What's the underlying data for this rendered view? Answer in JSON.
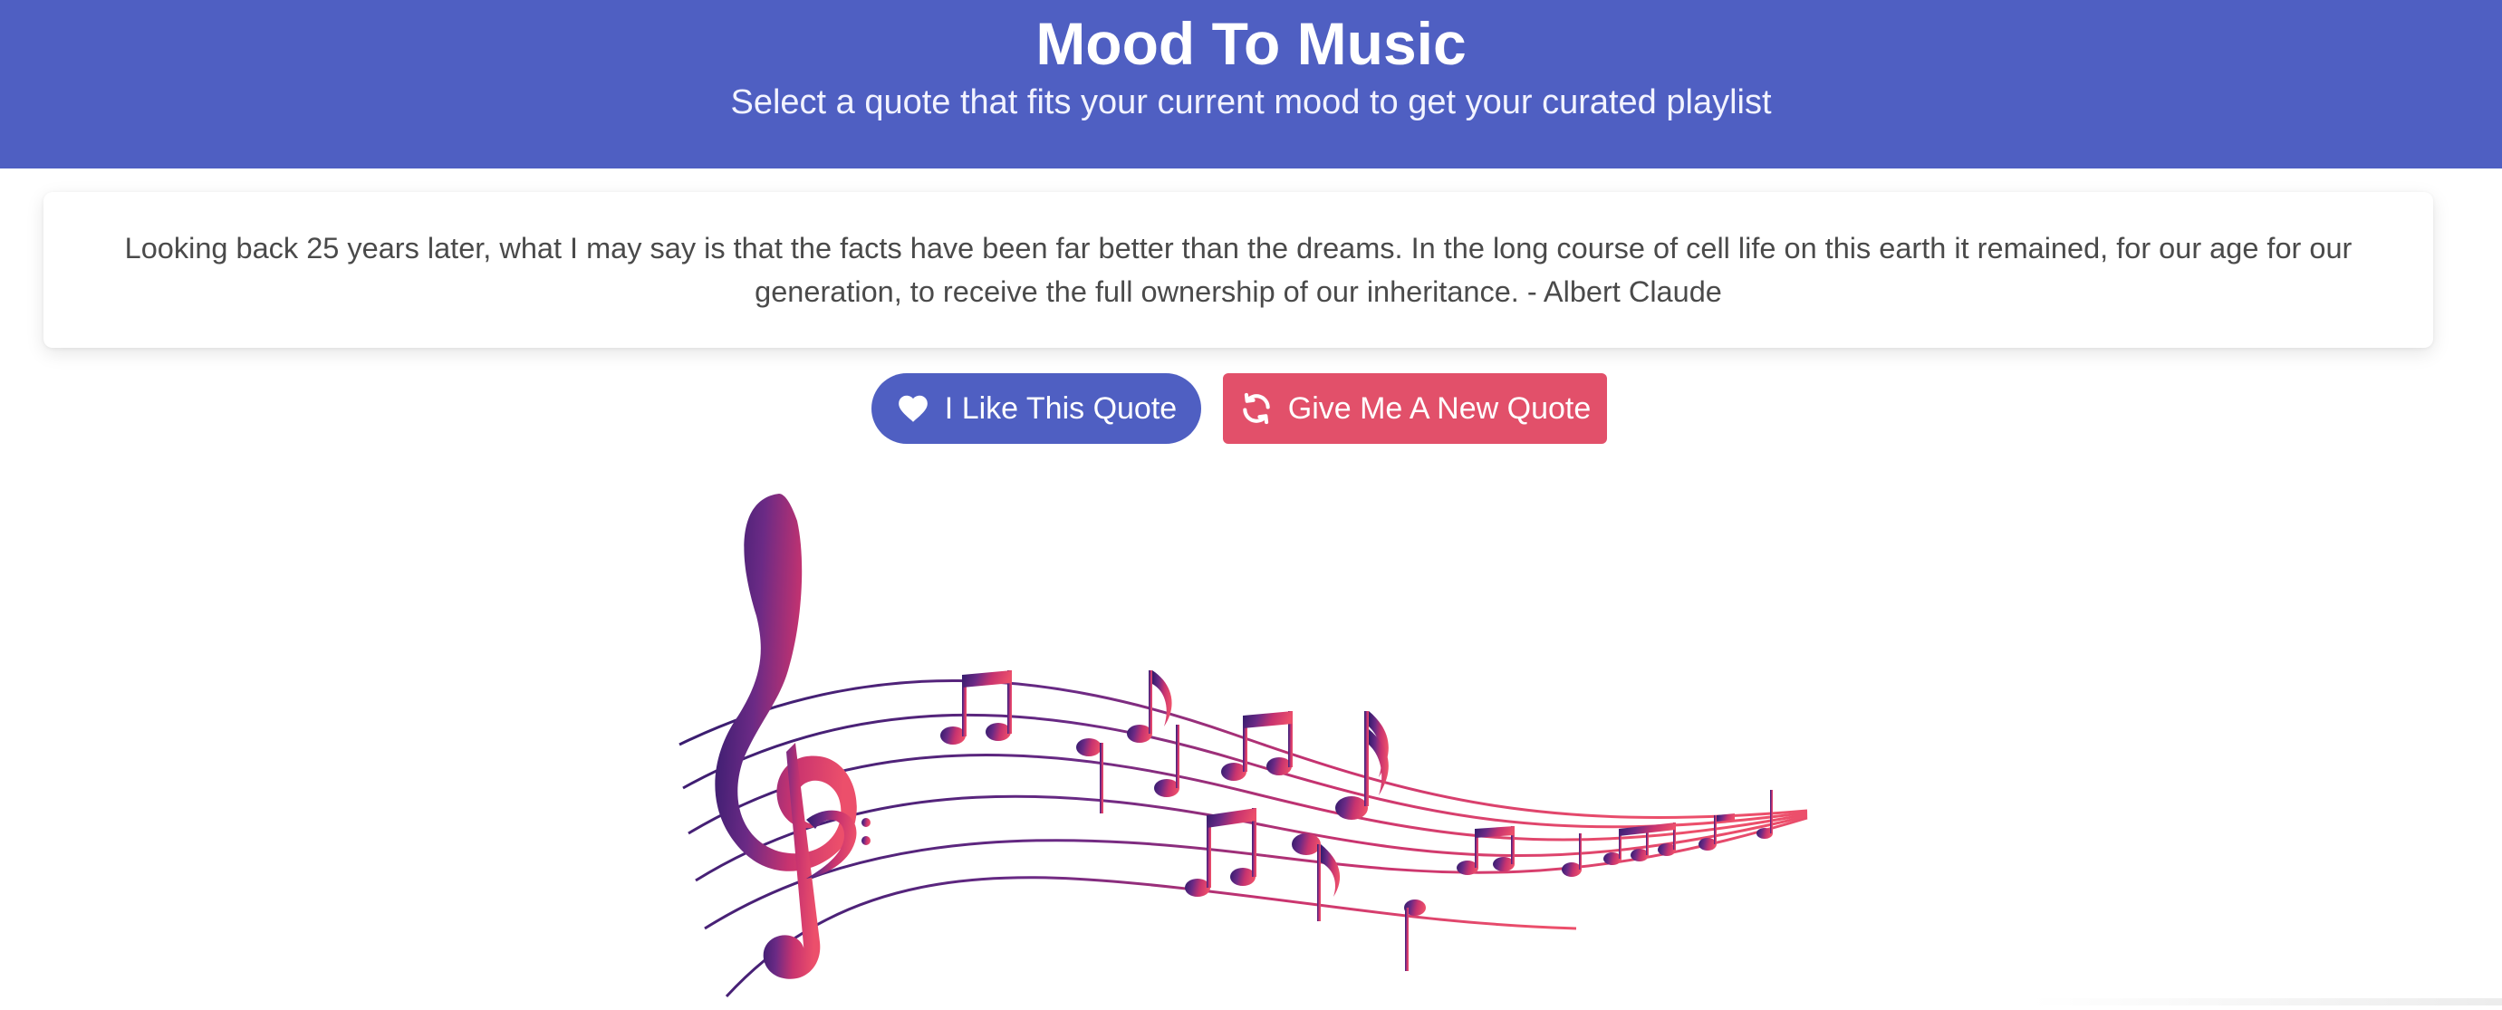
{
  "header": {
    "title": "Mood To Music",
    "subtitle": "Select a quote that fits your current mood to get your curated playlist"
  },
  "quote": {
    "text": "Looking back 25 years later, what I may say is that the facts have been far better than the dreams. In the long course of cell life on this earth it remained, for our age for our generation, to receive the full ownership of our inheritance. - Albert Claude"
  },
  "buttons": {
    "like_label": "I Like This Quote",
    "like_icon": "heart-icon",
    "new_label": "Give Me A New Quote",
    "new_icon": "refresh-icon"
  },
  "colors": {
    "header_bg": "#4f5fc2",
    "like_button": "#4f5fc2",
    "new_button": "#e2506a",
    "art_gradient_start": "#2e1a6b",
    "art_gradient_end": "#ec4f6b"
  },
  "illustration": {
    "icon": "music-staff-notes-illustration"
  }
}
